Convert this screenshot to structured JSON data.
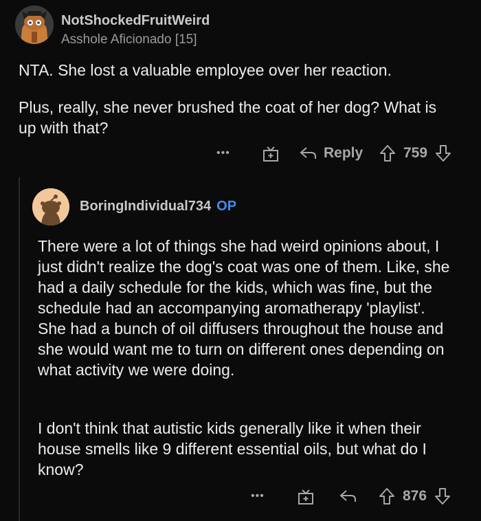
{
  "comment1": {
    "username": "NotShockedFruitWeird",
    "flair": "Asshole Aficionado [15]",
    "paragraphs": [
      "NTA.  She lost a valuable employee over her reaction.",
      "Plus, really, she never brushed the coat of her dog? What is up with that?"
    ],
    "actions": {
      "more": "•••",
      "reply_label": "Reply",
      "score": "759"
    }
  },
  "comment2": {
    "username": "BoringIndividual734",
    "op_badge": "OP",
    "paragraphs": [
      "There were a lot of things she had weird opinions about, I just didn't realize the dog's coat was one of them. Like, she had a daily schedule for the kids, which was fine, but the schedule had an accompanying aromatherapy 'playlist'. She had a bunch of oil diffusers throughout the house and she would want me to turn on different ones depending on what activity we were doing.",
      "I don't think that autistic kids generally like it when their house smells like 9 different essential oils, but what do I know?"
    ],
    "actions": {
      "more": "•••",
      "score": "876"
    }
  },
  "colors": {
    "background": "#0b0b0b",
    "op_blue": "#3f8cf0",
    "avatar2_bg": "#f2c79a"
  }
}
